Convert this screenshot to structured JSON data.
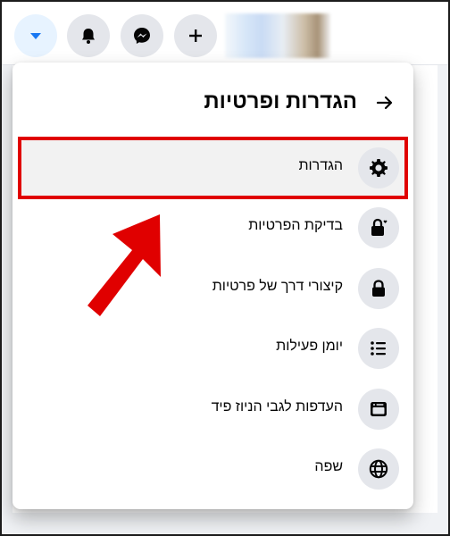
{
  "colors": {
    "accent": "#1877f2",
    "highlight": "#e00000",
    "icon_bg": "#e4e6eb"
  },
  "topbar": {
    "buttons": [
      {
        "name": "account-menu-button",
        "icon": "caret-down-icon"
      },
      {
        "name": "notifications-button",
        "icon": "bell-icon"
      },
      {
        "name": "messenger-button",
        "icon": "messenger-icon"
      },
      {
        "name": "create-button",
        "icon": "plus-icon"
      }
    ]
  },
  "menu": {
    "title": "הגדרות ופרטיות",
    "back_icon": "arrow-right-icon",
    "items": [
      {
        "label": "הגדרות",
        "icon": "gear-icon"
      },
      {
        "label": "בדיקת הפרטיות",
        "icon": "lock-heart-icon"
      },
      {
        "label": "קיצורי דרך של פרטיות",
        "icon": "lock-icon"
      },
      {
        "label": "יומן פעילות",
        "icon": "list-icon"
      },
      {
        "label": "העדפות לגבי הניוז פיד",
        "icon": "feed-icon"
      },
      {
        "label": "שפה",
        "icon": "globe-icon"
      }
    ]
  }
}
